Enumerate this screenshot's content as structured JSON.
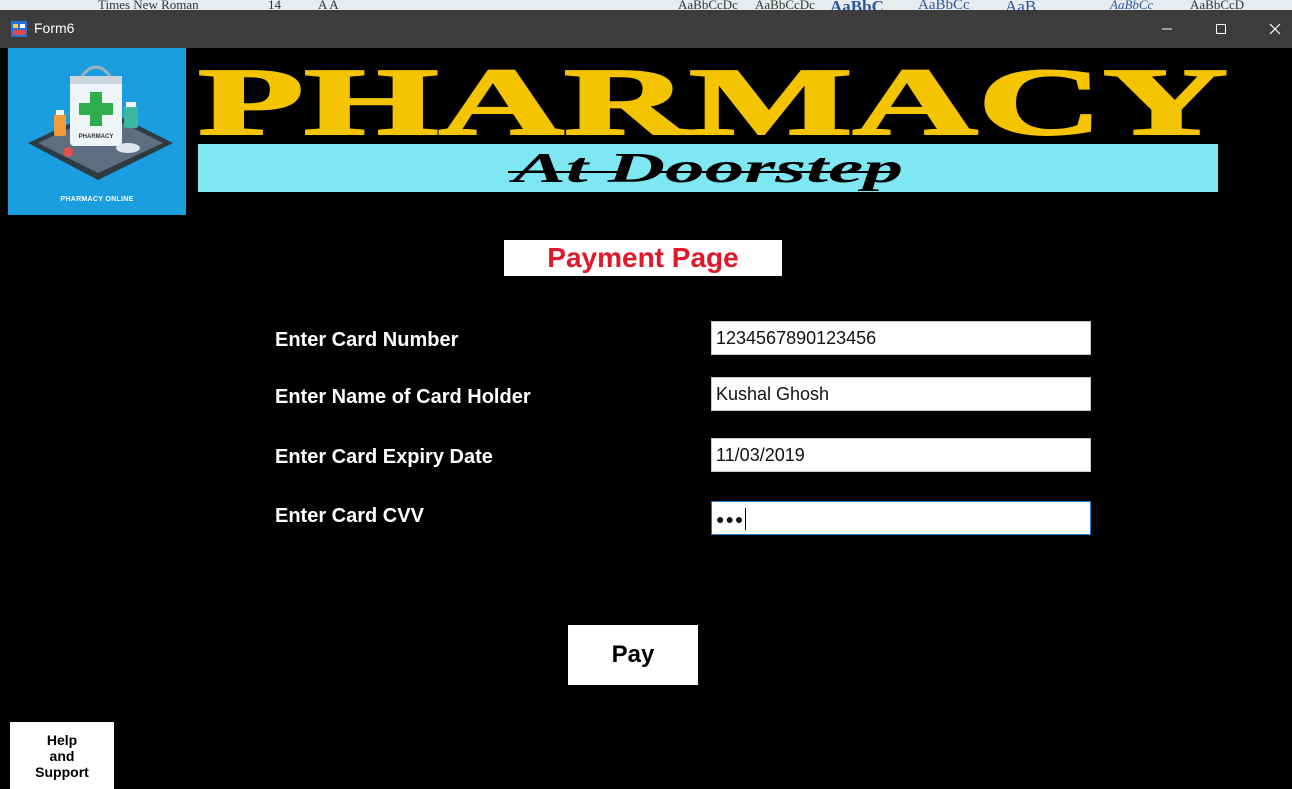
{
  "background_app": {
    "ribbon_texts": [
      "Times New Roman",
      "14",
      "A A",
      "AaBbCcDc",
      "AaBbCcDc",
      "AaBbC",
      "AaBbCc",
      "AaB",
      "AaBbCc",
      "AaBbCcD"
    ]
  },
  "window": {
    "title": "Form6",
    "minimize_label": "–",
    "maximize_label": "☐",
    "close_label": "✕"
  },
  "branding": {
    "logo_caption": "PHARMACY ONLINE",
    "logo_tag": "PHARMACY",
    "heading": "PHARMACY",
    "subheading": "At Doorstep"
  },
  "page": {
    "title": "Payment Page"
  },
  "form": {
    "card_number_label": "Enter Card Number",
    "card_number_value": "1234567890123456",
    "card_holder_label": "Enter Name of Card Holder",
    "card_holder_value": "Kushal Ghosh",
    "expiry_label": "Enter Card Expiry Date",
    "expiry_value": "11/03/2019",
    "cvv_label": "Enter Card CVV",
    "cvv_value": "●●●"
  },
  "buttons": {
    "pay": "Pay",
    "help": "Help\nand\nSupport"
  },
  "colors": {
    "heading_yellow": "#f5c400",
    "subtitle_bg": "#7fe7f2",
    "title_red": "#e0182a",
    "logo_bg": "#1a9ee0"
  }
}
